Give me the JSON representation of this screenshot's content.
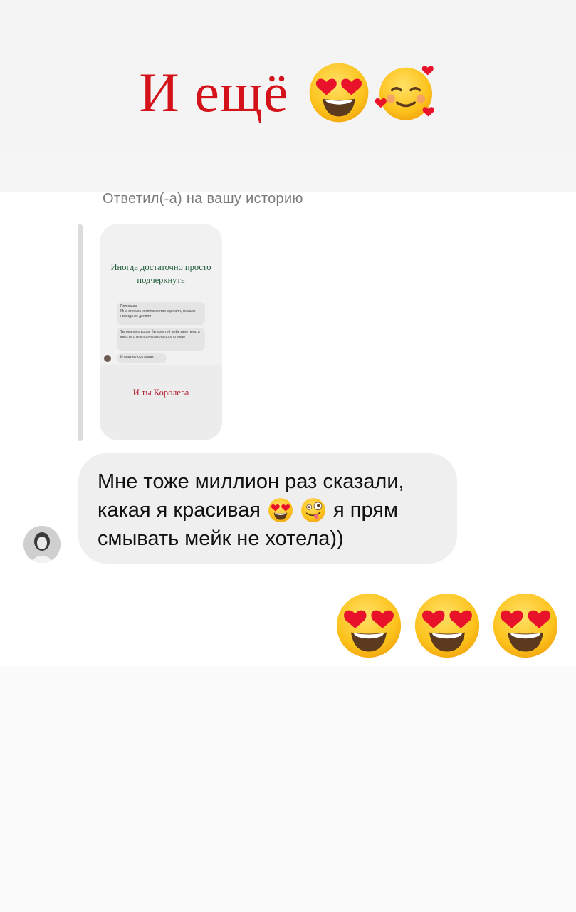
{
  "headline": {
    "text": "И ещё",
    "emojis": [
      "heart-eyes-emoji",
      "smiling-face-with-hearts-emoji"
    ],
    "color": "#d3121a"
  },
  "reply_label": "Ответил(-а) на вашу историю",
  "story_preview": {
    "title": "Иногда достаточно просто подчеркнуть",
    "messages": [
      "Полинааа\nМне столько комплиментов сделали, сколько никогда не делали",
      "Ты реально вроде бы простой мейк замутила, а вместе с тем подчеркнула просто лицо",
      "И подучилось вааах"
    ],
    "subtitle": "И ты Королева"
  },
  "message": {
    "line1": "Мне тоже миллион раз сказали,",
    "line2_start": "какая я красивая",
    "line2_end": "я прям",
    "line3": "смывать мейк не хотела))",
    "inline_emojis": [
      "heart-eyes-emoji",
      "zany-face-emoji"
    ]
  },
  "reactions": [
    "heart-eyes-emoji",
    "heart-eyes-emoji",
    "heart-eyes-emoji"
  ]
}
